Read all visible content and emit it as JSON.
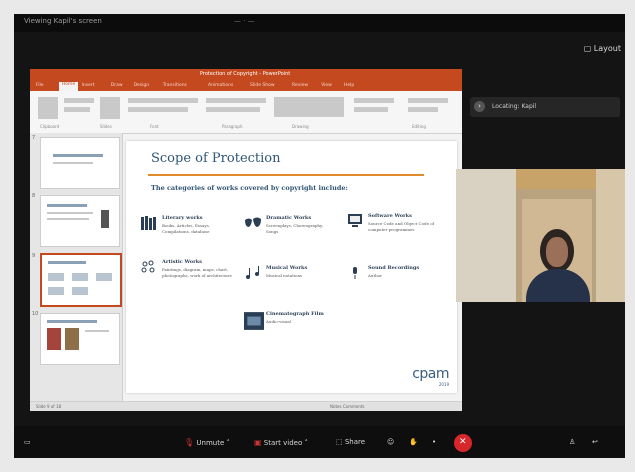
{
  "window": {
    "title": "Viewing Kapil's screen",
    "center_text": "— · —",
    "layout_button": "Layout"
  },
  "ppt": {
    "title_bar_text": "Protection of Copyright - PowerPoint",
    "tabs": [
      "File",
      "Home",
      "Insert",
      "Draw",
      "Design",
      "Transitions",
      "Animations",
      "Slide Show",
      "Review",
      "View",
      "Help"
    ],
    "active_tab_index": 1,
    "ribbon_groups": [
      "Clipboard",
      "Slides",
      "Font",
      "Paragraph",
      "Drawing",
      "Editing"
    ],
    "thumbnails": [
      "",
      "",
      "",
      ""
    ],
    "statusbar_left": "Slide 9 of 18",
    "statusbar_right": "Notes   Comments"
  },
  "slide": {
    "title": "Scope of Protection",
    "subtitle": "The categories of works covered by copyright include:",
    "works": [
      {
        "name": "Literary works",
        "desc": "Books, Articles, Essays, Compilations, database",
        "icon": "books-icon"
      },
      {
        "name": "Dramatic Works",
        "desc": "Screenplays, Choreography, Songs",
        "icon": "masks-icon"
      },
      {
        "name": "Software Works",
        "desc": "Source Code and Object Code of computer programmes",
        "icon": "computer-icon"
      },
      {
        "name": "Artistic Works",
        "desc": "Paintings, diagram, maps, chart, photographs, work of architecture",
        "icon": "palette-icon"
      },
      {
        "name": "Musical Works",
        "desc": "Musical notations",
        "icon": "music-notes-icon"
      },
      {
        "name": "Sound Recordings",
        "desc": "Author",
        "icon": "microphone-icon"
      },
      {
        "name": "Cinematograph Film",
        "desc": "Audio-visual",
        "icon": "film-icon"
      }
    ],
    "logo_text": "cpam",
    "logo_sub": "2019"
  },
  "participant": {
    "location_label": "Locating: Kapil",
    "name": ""
  },
  "toolbar": {
    "unmute": "Unmute",
    "start_video": "Start video",
    "share": "Share",
    "reactions": "",
    "colors": {
      "end": "#d8272b"
    }
  }
}
